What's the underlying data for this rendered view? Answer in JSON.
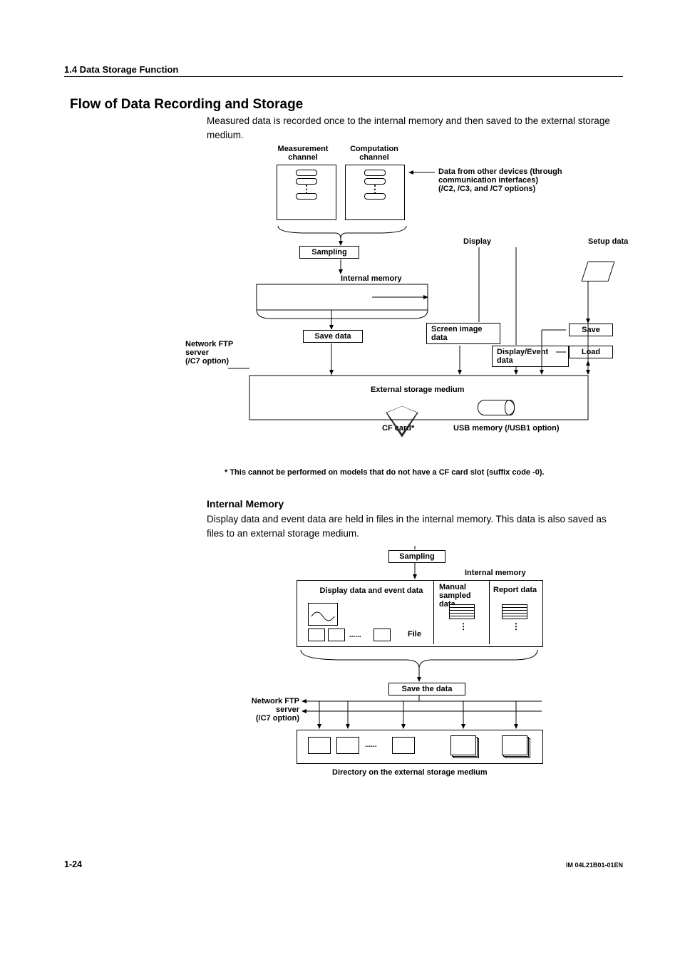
{
  "header": {
    "section": "1.4  Data Storage Function"
  },
  "title": "Flow of Data Recording and Storage",
  "intro": "Measured data is recorded once to the internal memory and then saved to the external storage medium.",
  "diag1": {
    "meas_channel": "Measurement\nchannel",
    "comp_channel": "Computation\nchannel",
    "data_from": "Data from other devices (through communication interfaces)\n(/C2, /C3, and /C7 options)",
    "sampling": "Sampling",
    "display": "Display",
    "setup_data": "Setup data",
    "internal_memory": "Internal memory",
    "save_data": "Save data",
    "screen_image": "Screen image data",
    "display_event": "Display/Event data",
    "save": "Save",
    "load": "Load",
    "ftp": "Network FTP server\n(/C7 option)",
    "ext_medium": "External storage medium",
    "cf_card": "CF card*",
    "usb_mem": "USB memory (/USB1 option)",
    "note": "* This cannot be performed on models that do not have a CF card slot (suffix code -0)."
  },
  "section2": {
    "head": "Internal Memory",
    "body": "Display data and event data are held in files in the internal memory. This data is also saved as files to an external storage medium."
  },
  "diag2": {
    "sampling": "Sampling",
    "internal_memory": "Internal memory",
    "dde": "Display data and event data",
    "manual": "Manual sampled data",
    "report": "Report data",
    "file": "File",
    "save_the_data": "Save the data",
    "ftp": "Network FTP server\n(/C7 option)",
    "dir": "Directory on the external storage medium"
  },
  "footer": {
    "page": "1-24",
    "doc": "IM 04L21B01-01EN"
  }
}
